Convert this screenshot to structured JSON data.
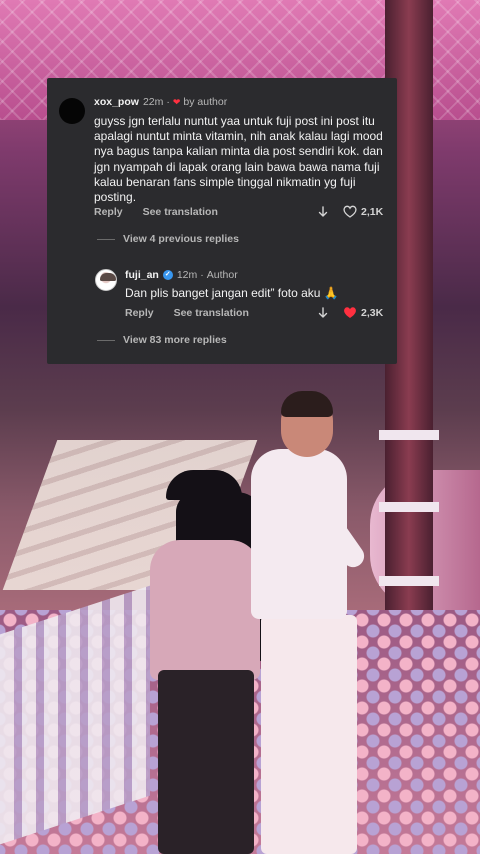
{
  "comments": [
    {
      "username": "xox_pow",
      "time": "22m",
      "liked_by": "by author",
      "text": "guyss jgn terlalu nuntut yaa untuk fuji post ini post itu apalagi nuntut minta vitamin, nih anak kalau lagi mood nya bagus tanpa kalian minta dia post sendiri kok. dan jgn nyampah di lapak orang lain bawa bawa nama fuji kalau benaran fans simple tinggal nikmatin yg fuji posting.",
      "reply_label": "Reply",
      "translate_label": "See translation",
      "like_count": "2,1K",
      "liked": false
    },
    {
      "username": "fuji_an",
      "time": "12m",
      "role": "Author",
      "text": "Dan plis banget jangan edit” foto aku 🙏",
      "reply_label": "Reply",
      "translate_label": "See translation",
      "like_count": "2,3K",
      "liked": true
    }
  ],
  "view_previous_replies": "View 4 previous replies",
  "view_more_replies": "View 83 more replies",
  "icons": {
    "like_by_author": "heart-icon",
    "verified": "verified-badge-icon",
    "dislike": "arrow-down-icon",
    "like": "heart-icon"
  },
  "colors": {
    "card_bg": "#2b2b2e",
    "like_red": "#ff3040",
    "verified_blue": "#3897f0"
  }
}
